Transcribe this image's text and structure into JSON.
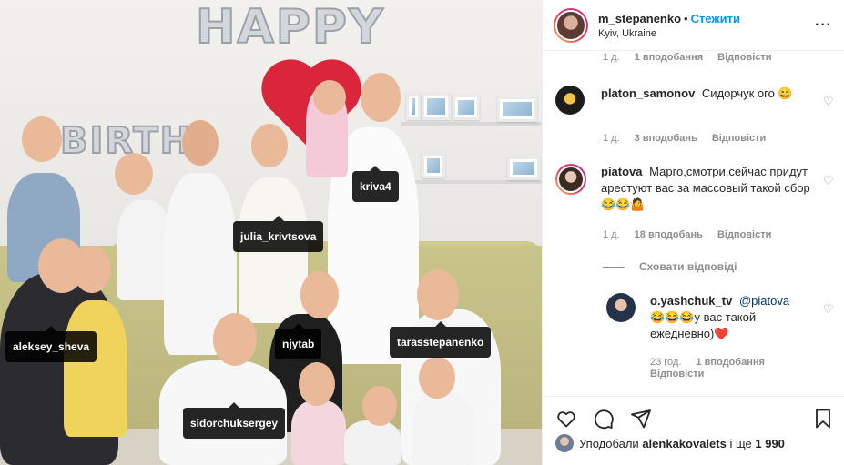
{
  "post": {
    "author": "m_stepanenko",
    "follow_label": "Стежити",
    "location": "Kyiv, Ukraine",
    "more_icon": "more-icon"
  },
  "photo": {
    "balloon_text": "HAPPY",
    "balloon_text_side": "BIRTH",
    "tags": [
      {
        "name": "kriva4"
      },
      {
        "name": "julia_krivtsova"
      },
      {
        "name": "aleksey_sheva"
      },
      {
        "name": "njytab"
      },
      {
        "name": "tarasstepanenko"
      },
      {
        "name": "sidorchuksergey"
      }
    ]
  },
  "comments": {
    "top_meta": {
      "time": "1 д.",
      "likes": "1 вподобання",
      "reply": "Відповісти"
    },
    "items": [
      {
        "username": "platon_samonov",
        "text": "Сидорчук ого 😄",
        "time": "1 д.",
        "likes": "3 вподобань",
        "reply": "Відповісти"
      },
      {
        "username": "piatova",
        "text": "Марго,смотри,сейчас придут арестуют вас за массовый такой сбор😂😂🤷",
        "time": "1 д.",
        "likes": "18 вподобань",
        "reply": "Відповісти"
      }
    ],
    "hide_replies": "Сховати відповіді",
    "reply": {
      "username": "o.yashchuk_tv",
      "mention": "@piatova",
      "text": "😂😂😂у вас такой ежедневно)❤️",
      "time": "23 год.",
      "likes": "1 вподобання",
      "reply": "Відповісти"
    }
  },
  "actions": {
    "like_icon": "heart-outline-icon",
    "comment_icon": "comment-icon",
    "share_icon": "share-icon",
    "save_icon": "bookmark-icon"
  },
  "likes_line": {
    "prefix": "Уподобали",
    "user": "alenkakovalets",
    "middle": "і ще",
    "count": "1 990"
  },
  "colors": {
    "accent": "#0095f6",
    "muted": "#8e8e8e",
    "text": "#262626"
  }
}
